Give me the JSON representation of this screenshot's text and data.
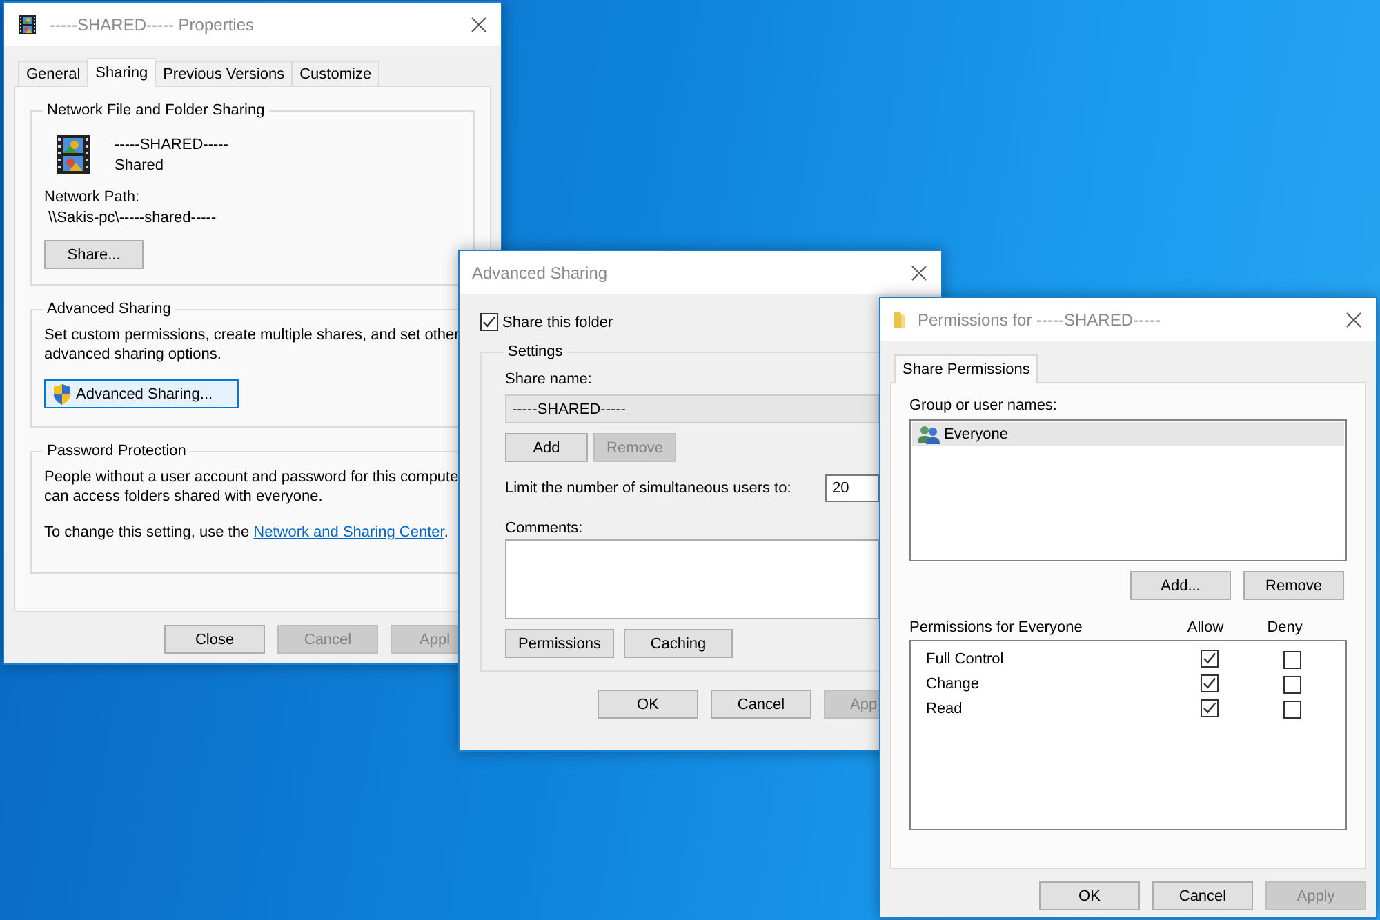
{
  "properties_window": {
    "title": "-----SHARED----- Properties",
    "tabs": [
      {
        "label": "General",
        "selected": false
      },
      {
        "label": "Sharing",
        "selected": true
      },
      {
        "label": "Previous Versions",
        "selected": false
      },
      {
        "label": "Customize",
        "selected": false
      }
    ],
    "network_sharing": {
      "heading": "Network File and Folder Sharing",
      "folder_name": "-----SHARED-----",
      "status": "Shared",
      "path_label": "Network Path:",
      "path": "\\\\Sakis-pc\\-----shared-----",
      "button": "Share..."
    },
    "advanced_sharing": {
      "heading": "Advanced Sharing",
      "description": "Set custom permissions, create multiple shares, and set other advanced sharing options.",
      "button": "Advanced Sharing..."
    },
    "password_protection": {
      "heading": "Password Protection",
      "description_lines": [
        "People without a user account and password for this compute",
        "can access folders shared with everyone."
      ],
      "note_before": "To change this setting, use the",
      "link": "Network and Sharing Center",
      "note_after": "."
    },
    "buttons": [
      {
        "label": "Close",
        "disabled": false
      },
      {
        "label": "Cancel",
        "disabled": true
      },
      {
        "label": "Appl",
        "disabled": true
      }
    ]
  },
  "advanced_window": {
    "title": "Advanced Sharing",
    "share_folder": {
      "label": "Share this folder",
      "checked": true
    },
    "settings_heading": "Settings",
    "share_name_label": "Share name:",
    "share_name": "-----SHARED-----",
    "name_buttons": [
      {
        "label": "Add",
        "disabled": false
      },
      {
        "label": "Remove",
        "disabled": true
      }
    ],
    "limit_label": "Limit the number of simultaneous users to:",
    "limit_value": "20",
    "comments_label": "Comments:",
    "option_buttons": [
      {
        "label": "Permissions",
        "disabled": false
      },
      {
        "label": "Caching",
        "disabled": false
      }
    ],
    "buttons": [
      {
        "label": "OK",
        "disabled": false
      },
      {
        "label": "Cancel",
        "disabled": false
      },
      {
        "label": "App",
        "disabled": true
      }
    ]
  },
  "permissions_window": {
    "title": "Permissions for -----SHARED-----",
    "tabs": [
      {
        "label": "Share Permissions",
        "selected": true
      }
    ],
    "group_label": "Group or user names:",
    "users": [
      {
        "name": "Everyone",
        "selected": true
      }
    ],
    "user_buttons": [
      {
        "label": "Add...",
        "disabled": false
      },
      {
        "label": "Remove",
        "disabled": false
      }
    ],
    "permissions_label": "Permissions for Everyone",
    "columns": [
      "Allow",
      "Deny"
    ],
    "permissions": [
      {
        "name": "Full Control",
        "allow": true,
        "deny": false
      },
      {
        "name": "Change",
        "allow": true,
        "deny": false
      },
      {
        "name": "Read",
        "allow": true,
        "deny": false
      }
    ],
    "buttons": [
      {
        "label": "OK",
        "disabled": false
      },
      {
        "label": "Cancel",
        "disabled": false
      },
      {
        "label": "Apply",
        "disabled": true
      }
    ]
  }
}
